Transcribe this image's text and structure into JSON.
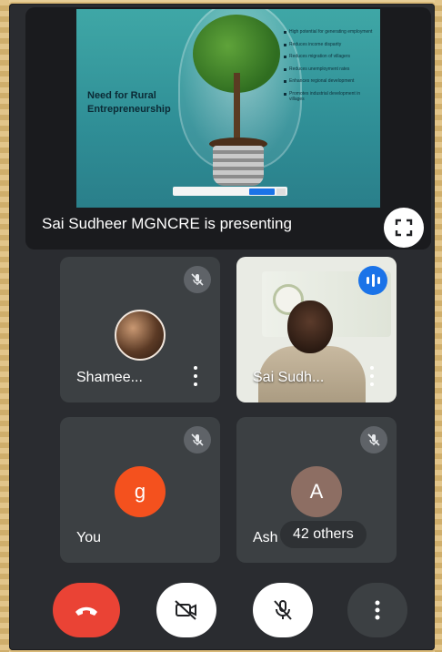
{
  "presentation": {
    "slide_title": "Need for Rural Entrepreneurship",
    "bullets": [
      "High potential for generating employment",
      "Reduces income disparity",
      "Reduces migration of villagers",
      "Reduces unemployment rates",
      "Enhances regional development",
      "Promotes industrial development in villages"
    ],
    "presenting_label": "Sai Sudheer MGNCRE is presenting"
  },
  "participants": [
    {
      "name": "Shamee...",
      "muted": true
    },
    {
      "name": "Sai Sudh...",
      "speaking": true
    },
    {
      "name": "You",
      "initial": "g",
      "muted": true,
      "color": "#f4511e"
    },
    {
      "name": "Ash",
      "initial": "A",
      "muted": true,
      "color": "#8d6e63"
    }
  ],
  "others_chip": "42 others",
  "controls": {
    "end_color": "#ea4335"
  }
}
